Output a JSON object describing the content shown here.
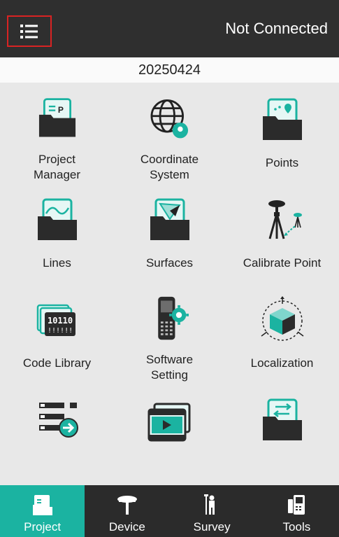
{
  "header": {
    "status": "Not Connected"
  },
  "project": {
    "name": "20250424"
  },
  "tiles": [
    {
      "label": "Project\nManager",
      "icon": "folder-project-icon"
    },
    {
      "label": "Coordinate\nSystem",
      "icon": "globe-pin-icon"
    },
    {
      "label": "Points",
      "icon": "folder-points-icon"
    },
    {
      "label": "Lines",
      "icon": "folder-lines-icon"
    },
    {
      "label": "Surfaces",
      "icon": "folder-surface-icon"
    },
    {
      "label": "Calibrate Point",
      "icon": "gnss-tripod-icon"
    },
    {
      "label": "Code Library",
      "icon": "code-library-icon"
    },
    {
      "label": "Software\nSetting",
      "icon": "controller-gear-icon"
    },
    {
      "label": "Localization",
      "icon": "cube-localization-icon"
    },
    {
      "label": "",
      "icon": "list-export-icon"
    },
    {
      "label": "",
      "icon": "video-tutorial-icon"
    },
    {
      "label": "",
      "icon": "folder-transfer-icon"
    }
  ],
  "nav": [
    {
      "label": "Project",
      "icon": "project-tab-icon",
      "active": true
    },
    {
      "label": "Device",
      "icon": "gnss-receiver-icon",
      "active": false
    },
    {
      "label": "Survey",
      "icon": "surveyor-icon",
      "active": false
    },
    {
      "label": "Tools",
      "icon": "controller-tools-icon",
      "active": false
    }
  ],
  "colors": {
    "accent": "#1bb3a1",
    "topbar": "#2f2f2f",
    "highlight": "#d92323"
  }
}
